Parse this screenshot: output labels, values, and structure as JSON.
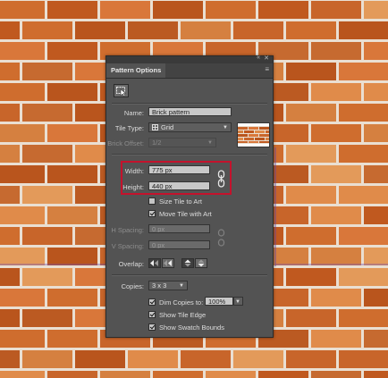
{
  "panel": {
    "title": "Pattern Options",
    "collapse_icon": "«",
    "close_icon": "✕",
    "menu_icon": "≡",
    "name_label": "Name:",
    "name_value": "Brick pattern",
    "tile_type_label": "Tile Type:",
    "tile_type_value": "Grid",
    "brick_offset_label": "Brick Offset:",
    "brick_offset_value": "1/2",
    "width_label": "Width:",
    "width_value": "775 px",
    "height_label": "Height:",
    "height_value": "440 px",
    "size_tile_to_art": "Size Tile to Art",
    "move_tile_with_art": "Move Tile with Art",
    "h_spacing_label": "H Spacing:",
    "h_spacing_value": "0 px",
    "v_spacing_label": "V Spacing:",
    "v_spacing_value": "0 px",
    "overlap_label": "Overlap:",
    "copies_label": "Copies:",
    "copies_value": "3 x 3",
    "dim_copies_label": "Dim Copies to:",
    "dim_copies_value": "100%",
    "show_tile_edge": "Show Tile Edge",
    "show_swatch_bounds": "Show Swatch Bounds",
    "checkboxes": {
      "size_tile_to_art": false,
      "move_tile_with_art": true,
      "dim_copies": true,
      "show_tile_edge": true,
      "show_swatch_bounds": true
    }
  },
  "colors": {
    "panel_bg": "#535353",
    "highlight": "#c4122c",
    "mortar": "#eadfd2",
    "brick_base": "#c8652a",
    "brick_light": "#e08b4a",
    "brick_dark": "#a34714"
  },
  "icons": {
    "tile_tool": "tile-edit-icon",
    "link": "chain-link-icon",
    "arrow": "chevron-down-icon"
  }
}
